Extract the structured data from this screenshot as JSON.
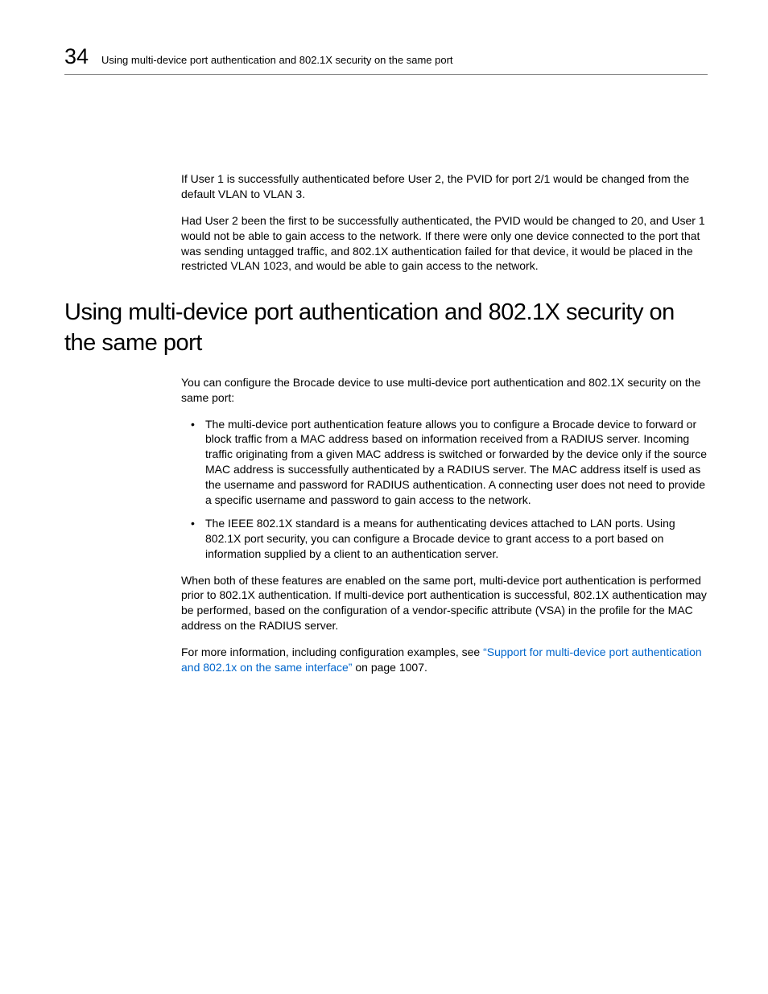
{
  "header": {
    "chapter_number": "34",
    "running_title": "Using multi-device port authentication and 802.1X security on the same port"
  },
  "intro_paras": [
    "If User 1 is successfully authenticated before User 2, the PVID for port 2/1 would be changed from the default VLAN to VLAN 3.",
    "Had User 2 been the first to be successfully authenticated, the PVID would be changed to 20, and User 1 would not be able to gain access to the network.  If there were only one device connected to the port that was sending untagged traffic, and 802.1X authentication failed for that device, it would be placed in the restricted VLAN 1023, and would be able to gain access to the network."
  ],
  "section": {
    "title": "Using multi-device port authentication and 802.1X security on the same port",
    "lead": "You can configure the Brocade device to use multi-device port authentication and 802.1X security on the same port:",
    "bullets": [
      "The multi-device port authentication feature allows you to configure a Brocade device to forward or block traffic from a MAC address based on information received from a RADIUS server.  Incoming traffic originating from a given MAC address is switched or forwarded by the device only if the source MAC address is successfully authenticated by a RADIUS server. The MAC address itself is used as the username and password for RADIUS authentication.  A connecting user does not need to provide a specific username and password to gain access to the network.",
      "The IEEE 802.1X standard is a means for authenticating devices attached to LAN ports.  Using 802.1X port security, you can configure a Brocade device to grant access to a port based on information supplied by a client to an authentication server."
    ],
    "after_para": "When both of these features are enabled on the same port, multi-device port authentication is performed prior to 802.1X authentication.  If multi-device port authentication is successful, 802.1X authentication may be performed, based on the configuration of a vendor-specific attribute (VSA) in the profile for the MAC address on the RADIUS server.",
    "more_info_prefix": "For more information, including configuration examples, see ",
    "more_info_link": "“Support for multi-device port authentication and 802.1x on the same interface”",
    "more_info_suffix": " on page 1007."
  }
}
